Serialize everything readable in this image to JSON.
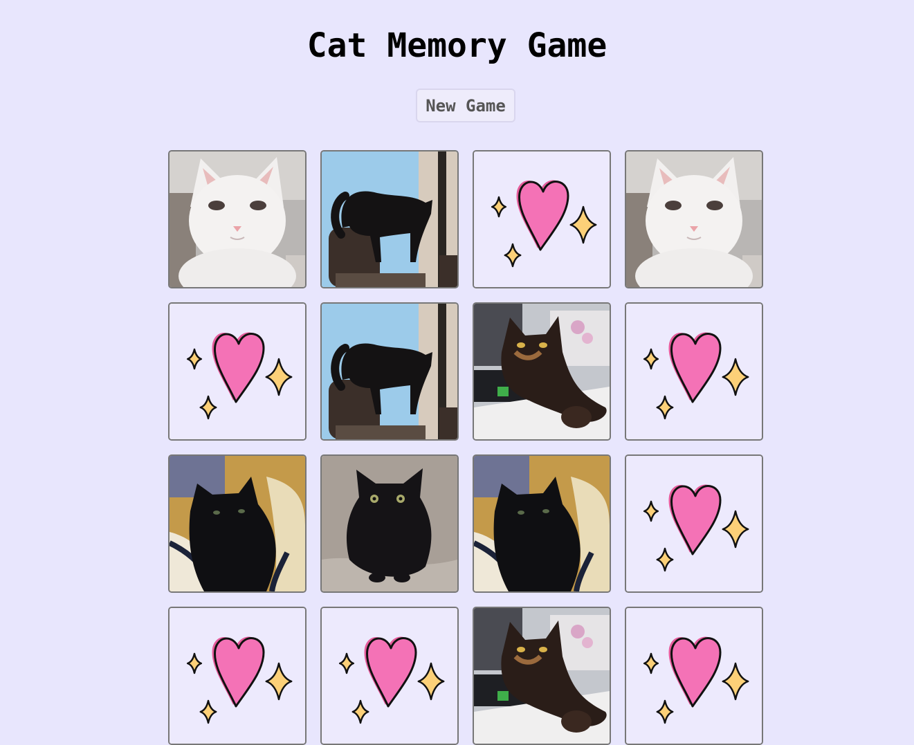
{
  "title": "Cat Memory Game",
  "new_game_label": "New Game",
  "cards": [
    {
      "state": "face-up",
      "photo": "white-cat"
    },
    {
      "state": "face-up",
      "photo": "black-cat-arched"
    },
    {
      "state": "face-down",
      "icon": "heart-sparkles-icon"
    },
    {
      "state": "face-up",
      "photo": "white-cat"
    },
    {
      "state": "face-down",
      "icon": "heart-sparkles-icon"
    },
    {
      "state": "face-up",
      "photo": "black-cat-arched"
    },
    {
      "state": "face-up",
      "photo": "tortoiseshell-cat"
    },
    {
      "state": "face-down",
      "icon": "heart-sparkles-icon"
    },
    {
      "state": "face-up",
      "photo": "black-cat-bed"
    },
    {
      "state": "face-up",
      "photo": "black-cat-sitting"
    },
    {
      "state": "face-up",
      "photo": "black-cat-bed"
    },
    {
      "state": "face-down",
      "icon": "heart-sparkles-icon"
    },
    {
      "state": "face-down",
      "icon": "heart-sparkles-icon"
    },
    {
      "state": "face-down",
      "icon": "heart-sparkles-icon"
    },
    {
      "state": "face-up",
      "photo": "tortoiseshell-cat"
    },
    {
      "state": "face-down",
      "icon": "heart-sparkles-icon"
    }
  ],
  "colors": {
    "background": "#e8e6fd",
    "card_back": "#edeafd",
    "heart": "#f472b6",
    "sparkle": "#fcd078"
  }
}
